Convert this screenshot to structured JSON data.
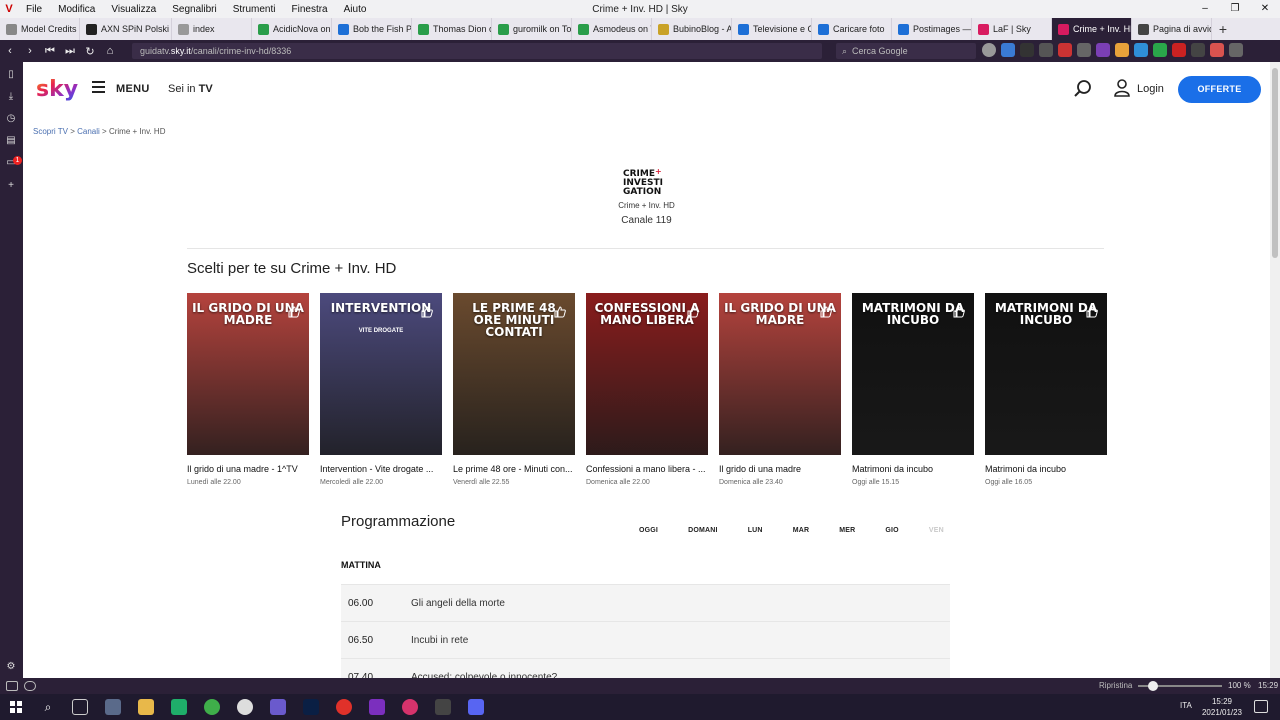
{
  "browser": {
    "window_title": "Crime + Inv. HD | Sky",
    "menu": [
      "File",
      "Modifica",
      "Visualizza",
      "Segnalibri",
      "Strumenti",
      "Finestra",
      "Aiuto"
    ],
    "window_controls": [
      "–",
      "❐",
      "✕"
    ],
    "tabs": [
      {
        "label": "Model Credits ·",
        "color": "#888888"
      },
      {
        "label": "AXN SPiN Polski",
        "color": "#222222"
      },
      {
        "label": "index",
        "color": "#999999"
      },
      {
        "label": "AcidicNova on T",
        "color": "#2a9d4a"
      },
      {
        "label": "Bob the Fish Pro",
        "color": "#1d6fd6"
      },
      {
        "label": "Thomas Dion o",
        "color": "#2a9d4a"
      },
      {
        "label": "guromilk on Toy",
        "color": "#2a9d4a"
      },
      {
        "label": "Asmodeus on T",
        "color": "#2a9d4a"
      },
      {
        "label": "BubinoBlog - A",
        "color": "#c9a227"
      },
      {
        "label": "Televisione e Ci",
        "color": "#1d6fd6"
      },
      {
        "label": "Caricare foto",
        "color": "#1d6fd6"
      },
      {
        "label": "Postimages — h",
        "color": "#1d6fd6"
      },
      {
        "label": "LaF | Sky",
        "color": "#d81b60"
      },
      {
        "label": "Crime + Inv. HD",
        "color": "#d81b60"
      },
      {
        "label": "Pagina di avvio",
        "color": "#444444"
      }
    ],
    "active_tab": 13,
    "url_prefix": "guidatv.",
    "url_domain": "sky.it",
    "url_path": "/canali/crime-inv-hd/8336",
    "search_placeholder": "Cerca Google"
  },
  "header": {
    "logo_text": "sky",
    "menu_label": "MENU",
    "sei_in": "Sei in",
    "sei_in_bold": "TV",
    "login_label": "Login",
    "offerte_label": "OFFERTE"
  },
  "breadcrumb": {
    "items": [
      "Scopri TV",
      "Canali",
      "Crime + Inv. HD"
    ],
    "separator": ">"
  },
  "channel": {
    "logo_lines": [
      "CRIME",
      "INVESTI",
      "GATION"
    ],
    "name": "Crime + Inv. HD",
    "number_label": "Canale 119"
  },
  "picks": {
    "title": "Scelti per te su Crime + Inv. HD",
    "cards": [
      {
        "poster_title": "IL GRIDO DI UNA MADRE",
        "poster_sub": "",
        "title": "Il grido di una madre - 1^TV",
        "time": "Lunedì alle 22.00",
        "bg": "#b5433d"
      },
      {
        "poster_title": "INTERVENTION",
        "poster_sub": "VITE DROGATE",
        "title": "Intervention - Vite drogate ...",
        "time": "Mercoledì alle 22.00",
        "bg": "#4c4a7d"
      },
      {
        "poster_title": "LE PRIME 48 ORE MINUTI CONTATI",
        "poster_sub": "",
        "title": "Le prime 48 ore - Minuti con...",
        "time": "Venerdì alle 22.55",
        "bg": "#6a4a2e"
      },
      {
        "poster_title": "CONFESSIONI A MANO LIBERA",
        "poster_sub": "",
        "title": "Confessioni a mano libera - ...",
        "time": "Domenica alle 22.00",
        "bg": "#8a1d1d"
      },
      {
        "poster_title": "IL GRIDO DI UNA MADRE",
        "poster_sub": "",
        "title": "Il grido di una madre",
        "time": "Domenica alle 23.40",
        "bg": "#b5433d"
      },
      {
        "poster_title": "MATRIMONI DA INCUBO",
        "poster_sub": "",
        "title": "Matrimoni da incubo",
        "time": "Oggi alle 15.15",
        "bg": "#111111"
      },
      {
        "poster_title": "MATRIMONI DA INCUBO",
        "poster_sub": "",
        "title": "Matrimoni da incubo",
        "time": "Oggi alle 16.05",
        "bg": "#111111"
      }
    ]
  },
  "schedule": {
    "title": "Programmazione",
    "days": [
      "OGGI",
      "DOMANI",
      "LUN",
      "MAR",
      "MER",
      "GIO",
      "VEN"
    ],
    "disabled_day": "VEN",
    "slot_label": "MATTINA",
    "rows": [
      {
        "time": "06.00",
        "program": "Gli angeli della morte"
      },
      {
        "time": "06.50",
        "program": "Incubi in rete"
      },
      {
        "time": "07.40",
        "program": "Accused: colpevole o innocente?"
      }
    ]
  },
  "statusbar": {
    "ripristina": "Ripristina",
    "zoom": "100 %",
    "time": "15:29"
  },
  "taskbar": {
    "language": "ITA",
    "clock_time": "15:29",
    "clock_date": "2021/01/23"
  },
  "colors": {
    "accent_blue": "#1a6fe8",
    "browser_dark": "#2b2037"
  }
}
